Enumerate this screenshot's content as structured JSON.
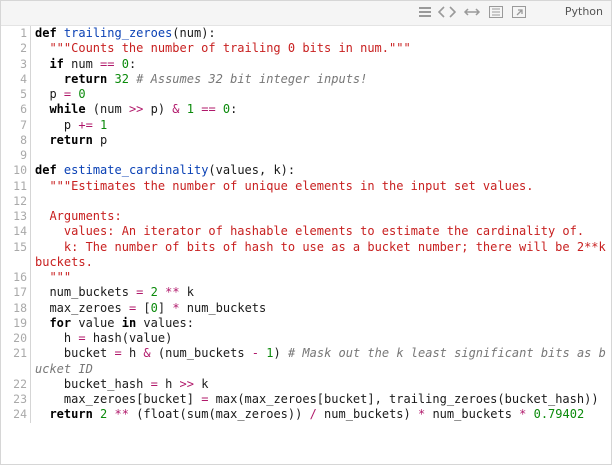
{
  "toolbar": {
    "language": "Python",
    "icons": [
      "view-source-icon",
      "highlight-icon",
      "wrap-icon",
      "copy-icon",
      "popup-icon"
    ]
  },
  "code": [
    {
      "n": "1",
      "tokens": [
        [
          "k",
          "def"
        ],
        [
          "t",
          " "
        ],
        [
          "f",
          "trailing_zeroes"
        ],
        [
          "t",
          "(num):"
        ]
      ]
    },
    {
      "n": "2",
      "tokens": [
        [
          "t",
          "  "
        ],
        [
          "s",
          "\"\"\"Counts the number of trailing 0 bits in num.\"\"\""
        ]
      ]
    },
    {
      "n": "3",
      "tokens": [
        [
          "t",
          "  "
        ],
        [
          "k",
          "if"
        ],
        [
          "t",
          " num "
        ],
        [
          "o",
          "=="
        ],
        [
          "t",
          " "
        ],
        [
          "n",
          "0"
        ],
        [
          "t",
          ":"
        ]
      ]
    },
    {
      "n": "4",
      "tokens": [
        [
          "t",
          "    "
        ],
        [
          "k",
          "return"
        ],
        [
          "t",
          " "
        ],
        [
          "n",
          "32"
        ],
        [
          "t",
          " "
        ],
        [
          "c",
          "# Assumes 32 bit integer inputs!"
        ]
      ]
    },
    {
      "n": "5",
      "tokens": [
        [
          "t",
          "  p "
        ],
        [
          "o",
          "="
        ],
        [
          "t",
          " "
        ],
        [
          "n",
          "0"
        ]
      ]
    },
    {
      "n": "6",
      "tokens": [
        [
          "t",
          "  "
        ],
        [
          "k",
          "while"
        ],
        [
          "t",
          " (num "
        ],
        [
          "o",
          ">>"
        ],
        [
          "t",
          " p) "
        ],
        [
          "o",
          "&"
        ],
        [
          "t",
          " "
        ],
        [
          "n",
          "1"
        ],
        [
          "t",
          " "
        ],
        [
          "o",
          "=="
        ],
        [
          "t",
          " "
        ],
        [
          "n",
          "0"
        ],
        [
          "t",
          ":"
        ]
      ]
    },
    {
      "n": "7",
      "tokens": [
        [
          "t",
          "    p "
        ],
        [
          "o",
          "+="
        ],
        [
          "t",
          " "
        ],
        [
          "n",
          "1"
        ]
      ]
    },
    {
      "n": "8",
      "tokens": [
        [
          "t",
          "  "
        ],
        [
          "k",
          "return"
        ],
        [
          "t",
          " p"
        ]
      ]
    },
    {
      "n": "9",
      "tokens": [
        [
          "t",
          " "
        ]
      ]
    },
    {
      "n": "10",
      "tokens": [
        [
          "k",
          "def"
        ],
        [
          "t",
          " "
        ],
        [
          "f",
          "estimate_cardinality"
        ],
        [
          "t",
          "(values, k):"
        ]
      ]
    },
    {
      "n": "11",
      "tokens": [
        [
          "t",
          "  "
        ],
        [
          "s",
          "\"\"\"Estimates the number of unique elements in the input set values."
        ]
      ]
    },
    {
      "n": "12",
      "tokens": [
        [
          "t",
          " "
        ]
      ]
    },
    {
      "n": "13",
      "tokens": [
        [
          "s",
          "  Arguments:"
        ]
      ]
    },
    {
      "n": "14",
      "tokens": [
        [
          "s",
          "    values: An iterator of hashable elements to estimate the cardinality of."
        ]
      ]
    },
    {
      "n": "15",
      "tokens": [
        [
          "s",
          "    k: The number of bits of hash to use as a bucket number; there will be 2**k buckets."
        ]
      ]
    },
    {
      "n": "16",
      "tokens": [
        [
          "s",
          "  \"\"\""
        ]
      ]
    },
    {
      "n": "17",
      "tokens": [
        [
          "t",
          "  num_buckets "
        ],
        [
          "o",
          "="
        ],
        [
          "t",
          " "
        ],
        [
          "n",
          "2"
        ],
        [
          "t",
          " "
        ],
        [
          "o",
          "**"
        ],
        [
          "t",
          " k"
        ]
      ]
    },
    {
      "n": "18",
      "tokens": [
        [
          "t",
          "  max_zeroes "
        ],
        [
          "o",
          "="
        ],
        [
          "t",
          " ["
        ],
        [
          "n",
          "0"
        ],
        [
          "t",
          "] "
        ],
        [
          "o",
          "*"
        ],
        [
          "t",
          " num_buckets"
        ]
      ]
    },
    {
      "n": "19",
      "tokens": [
        [
          "t",
          "  "
        ],
        [
          "k",
          "for"
        ],
        [
          "t",
          " value "
        ],
        [
          "k",
          "in"
        ],
        [
          "t",
          " values:"
        ]
      ]
    },
    {
      "n": "20",
      "tokens": [
        [
          "t",
          "    h "
        ],
        [
          "o",
          "="
        ],
        [
          "t",
          " hash(value)"
        ]
      ]
    },
    {
      "n": "21",
      "tokens": [
        [
          "t",
          "    bucket "
        ],
        [
          "o",
          "="
        ],
        [
          "t",
          " h "
        ],
        [
          "o",
          "&"
        ],
        [
          "t",
          " (num_buckets "
        ],
        [
          "o",
          "-"
        ],
        [
          "t",
          " "
        ],
        [
          "n",
          "1"
        ],
        [
          "t",
          ") "
        ],
        [
          "c",
          "# Mask out the k least significant bits as bucket ID"
        ]
      ]
    },
    {
      "n": "22",
      "tokens": [
        [
          "t",
          "    bucket_hash "
        ],
        [
          "o",
          "="
        ],
        [
          "t",
          " h "
        ],
        [
          "o",
          ">>"
        ],
        [
          "t",
          " k"
        ]
      ]
    },
    {
      "n": "23",
      "tokens": [
        [
          "t",
          "    max_zeroes[bucket] "
        ],
        [
          "o",
          "="
        ],
        [
          "t",
          " max(max_zeroes[bucket], trailing_zeroes(bucket_hash))"
        ]
      ]
    },
    {
      "n": "24",
      "tokens": [
        [
          "t",
          "  "
        ],
        [
          "k",
          "return"
        ],
        [
          "t",
          " "
        ],
        [
          "n",
          "2"
        ],
        [
          "t",
          " "
        ],
        [
          "o",
          "**"
        ],
        [
          "t",
          " (float(sum(max_zeroes)) "
        ],
        [
          "o",
          "/"
        ],
        [
          "t",
          " num_buckets) "
        ],
        [
          "o",
          "*"
        ],
        [
          "t",
          " num_buckets "
        ],
        [
          "o",
          "*"
        ],
        [
          "t",
          " "
        ],
        [
          "n",
          "0.79402"
        ]
      ]
    }
  ]
}
